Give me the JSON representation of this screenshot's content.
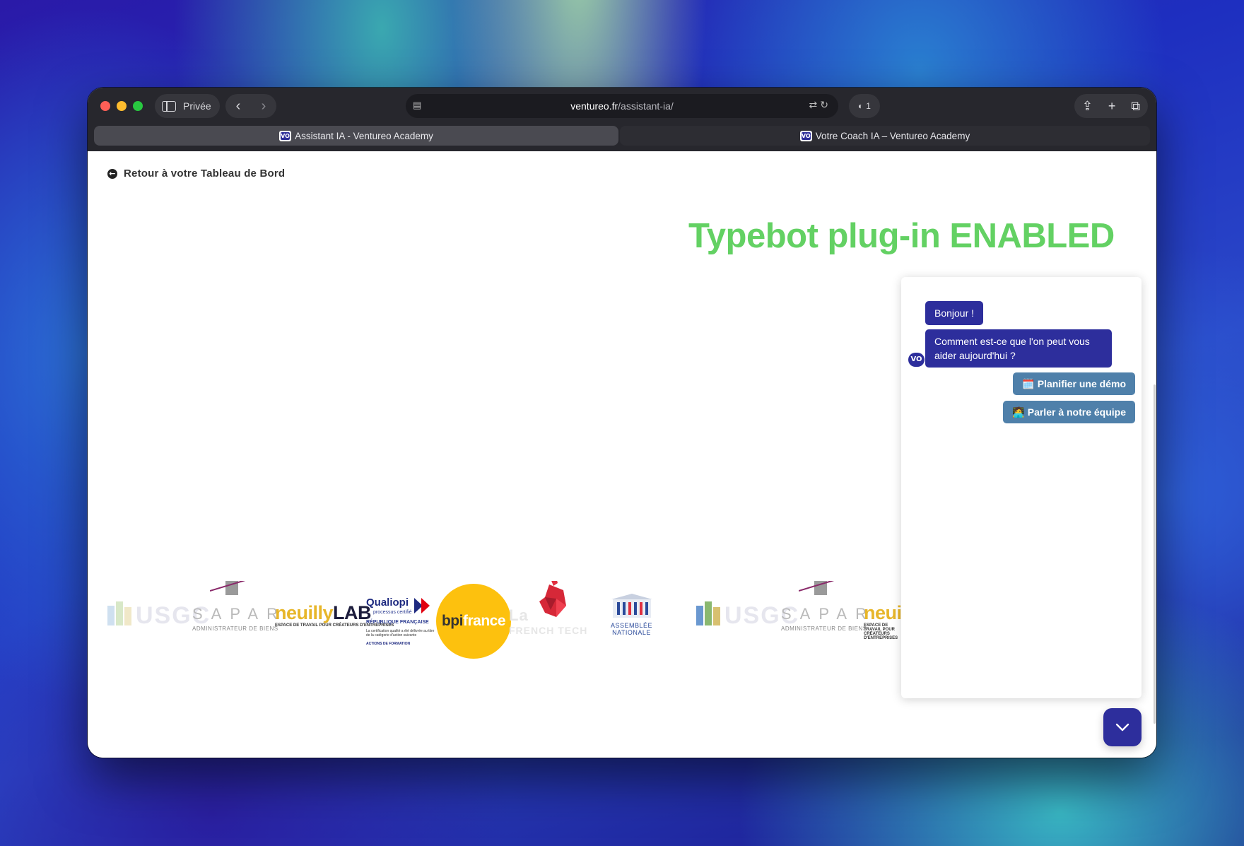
{
  "browser": {
    "sidebar_label": "Privée",
    "url_host": "ventureo.fr",
    "url_path": "/assistant-ia/",
    "tracker_count": "1",
    "tabs": [
      {
        "label": "Assistant IA - Ventureo Academy",
        "active": true
      },
      {
        "label": "Votre Coach IA – Ventureo Academy",
        "active": false
      }
    ],
    "favicon_text": "VO"
  },
  "page": {
    "back_link": "Retour à votre Tableau de Bord",
    "plugin_status": "Typebot plug-in ENABLED"
  },
  "chat": {
    "avatar_text": "VO",
    "messages": [
      {
        "text": "Bonjour !"
      },
      {
        "text": "Comment est-ce que l'on peut vous aider aujourd'hui ?"
      }
    ],
    "choices": [
      {
        "text": "🗓️ Planifier une démo"
      },
      {
        "text": "🧑‍💻 Parler à notre équipe"
      }
    ],
    "accent_color": "#2d2e9c",
    "choice_color": "#4f80aa"
  },
  "logos": {
    "usgc": "USGC",
    "sapar": "SAPAR",
    "sapar_sub": "ADMINISTRATEUR DE BIENS",
    "neuilly_a": "neuilly",
    "neuilly_b": "LAB",
    "neuilly_sub": "ESPACE DE TRAVAIL POUR CRÉATEURS D'ENTREPRISES",
    "qualiopi": "Qualiopi",
    "qualiopi_sub": "processus certifié",
    "qualiopi_rf": "RÉPUBLIQUE FRANÇAISE",
    "qualiopi_small": "La certification qualité a été délivrée au titre de la catégorie d'action suivante",
    "qualiopi_actions": "ACTIONS DE FORMATION",
    "bpi_a": "bpi",
    "bpi_b": "france",
    "frenchtech_a": "La",
    "frenchtech_b": "FRENCH TECH",
    "assemblee_a": "ASSEMBLÉE",
    "assemblee_b": "NATIONALE"
  }
}
